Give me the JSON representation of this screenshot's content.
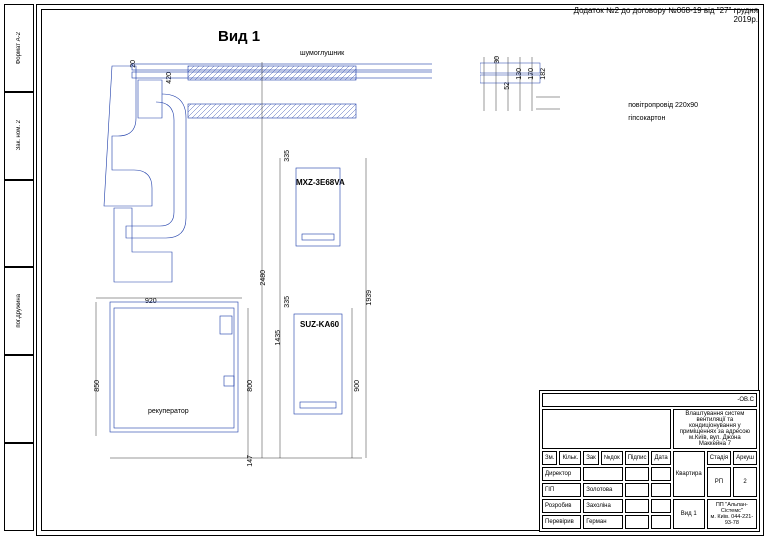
{
  "header": {
    "line1": "Додаток №2 до договору №068-19 від \"27\" грудня",
    "line2": "2019р."
  },
  "view_title": "Вид 1",
  "notes": {
    "silencer": "шумоглушник",
    "aircond1": "повітропровід 220х90",
    "plasterboard": "гіпсокартон",
    "recuperator": "рекуператор"
  },
  "equipment": {
    "unit1": "MXZ-3E68VA",
    "unit2": "SUZ-KA60"
  },
  "dims": {
    "d20": "20",
    "d420": "420",
    "d30": "30",
    "d52": "52",
    "d130": "130",
    "d170": "170",
    "d182": "182",
    "d335a": "335",
    "d335b": "335",
    "d2480": "2480",
    "d1435": "1435",
    "d1939": "1939",
    "d920": "920",
    "d850": "850",
    "d800": "800",
    "d900": "900",
    "d147": "147"
  },
  "rail": {
    "r1": "Формат А-2",
    "r2": "Зак. ном. 2",
    "r3": "",
    "r4": "пог.дружина",
    "r5": "",
    "r6": ""
  },
  "titleblock": {
    "code": "-ОВ.С",
    "desc": "Влаштування систем вентиляції та кондиціонування у приміщеннях за адресою м.Київ, вул. Джона Маккейна 7",
    "obj": "Квартира",
    "sheet_title": "Вид 1",
    "stage_h": "Стадія",
    "sheet_h": "Аркуш",
    "sheets_h": "Аркушів",
    "stage": "РП",
    "sheet": "2",
    "c1": "Зм.",
    "c2": "Кільк.",
    "c3": "Зак",
    "c4": "№док",
    "c5": "Підпис",
    "c6": "Дата",
    "r_dir": "Директор",
    "r_gip": "ГІП",
    "val_gip": "Золотова",
    "r_dev": "Розробив",
    "val_dev": "Захоліна",
    "r_chk": "Перевірив",
    "val_chk": "Герман",
    "company": "ПП \"Альпан-Сістемс\"\nм. Київ. 044-221-93-78"
  }
}
